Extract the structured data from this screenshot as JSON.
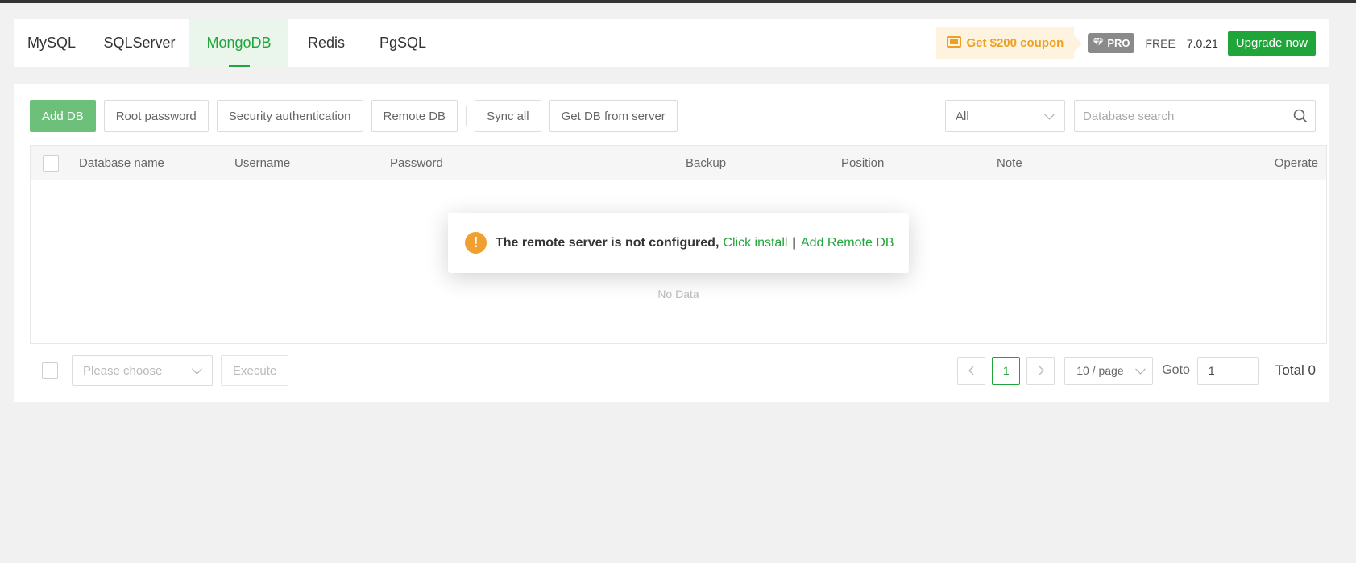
{
  "tabs": [
    {
      "label": "MySQL",
      "active": false
    },
    {
      "label": "SQLServer",
      "active": false
    },
    {
      "label": "MongoDB",
      "active": true
    },
    {
      "label": "Redis",
      "active": false
    },
    {
      "label": "PgSQL",
      "active": false
    }
  ],
  "header": {
    "coupon_label": "Get $200 coupon",
    "pro_label": "PRO",
    "free_label": "FREE",
    "version": "7.0.21",
    "upgrade_label": "Upgrade now"
  },
  "toolbar": {
    "add_db": "Add DB",
    "root_password": "Root password",
    "security_auth": "Security authentication",
    "remote_db": "Remote DB",
    "sync_all": "Sync all",
    "get_db": "Get DB from server",
    "filter_value": "All",
    "search_placeholder": "Database search"
  },
  "table": {
    "columns": [
      "Database name",
      "Username",
      "Password",
      "Backup",
      "Position",
      "Note",
      "Operate"
    ],
    "empty_text": "No Data"
  },
  "popup": {
    "message": "The remote server is not configured,",
    "link_install": "Click install",
    "separator": "|",
    "link_add_remote": "Add Remote DB"
  },
  "footer": {
    "batch_placeholder": "Please choose",
    "execute_label": "Execute",
    "current_page": "1",
    "page_size": "10 / page",
    "goto_label": "Goto",
    "goto_value": "1",
    "total_label": "Total 0"
  },
  "colors": {
    "accent": "#20a53a",
    "primary_button": "#6cc07a",
    "coupon_text": "#f0a020",
    "warning": "#f0a030"
  }
}
